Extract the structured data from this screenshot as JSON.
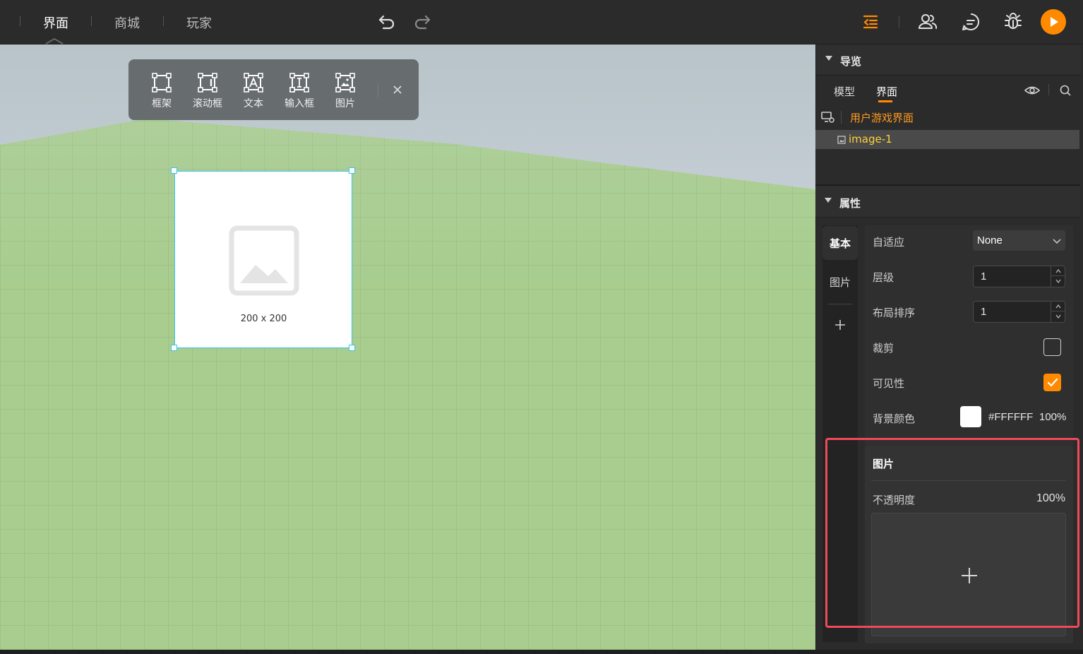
{
  "topbar": {
    "tabs": [
      "界面",
      "商城",
      "玩家"
    ],
    "active_tab": "界面"
  },
  "widget_toolbar": {
    "items": [
      "框架",
      "滚动框",
      "文本",
      "输入框",
      "图片"
    ]
  },
  "canvas": {
    "selected_size": "200 x 200"
  },
  "navigator": {
    "title": "导览",
    "tabs": [
      "模型",
      "界面"
    ],
    "active_tab": "界面",
    "root_label": "用户游戏界面",
    "item_label": "image-1"
  },
  "properties": {
    "title": "属性",
    "side_tabs": [
      "基本",
      "图片"
    ],
    "active_side_tab": "基本",
    "rows": {
      "adaptive_label": "自适应",
      "adaptive_value": "None",
      "layer_label": "层级",
      "layer_value": "1",
      "layout_order_label": "布局排序",
      "layout_order_value": "1",
      "clip_label": "裁剪",
      "clip_checked": false,
      "visible_label": "可见性",
      "visible_checked": true,
      "bg_color_label": "背景颜色",
      "bg_color_hex": "#FFFFFF",
      "bg_color_opacity": "100%"
    },
    "image_section": {
      "title": "图片",
      "opacity_label": "不透明度",
      "opacity_value": "100%"
    }
  },
  "colors": {
    "accent": "#ff8a00",
    "selection": "#34c6e8",
    "highlight": "#ef4a5a"
  }
}
